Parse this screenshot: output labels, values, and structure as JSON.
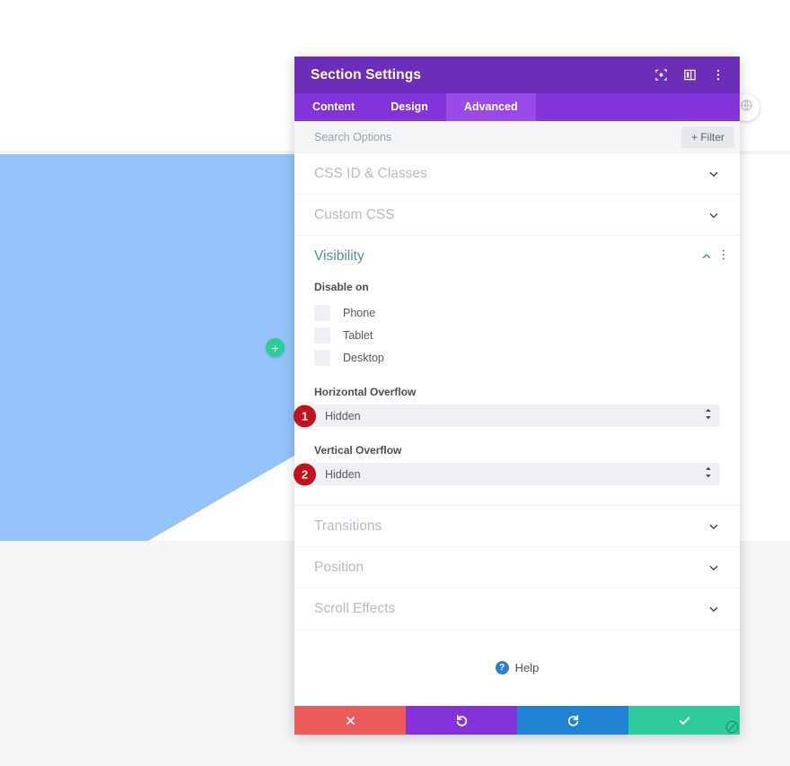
{
  "canvas": {
    "add_section_label": "+",
    "add_section_icon": "plus-icon",
    "round_tool_icon": "globe-settings-icon",
    "section_color": "#94c4fa",
    "add_button_color": "#2ecc9b"
  },
  "modal": {
    "title": "Section Settings",
    "header_icons": [
      {
        "name": "focus-icon",
        "label": ""
      },
      {
        "name": "layout-columns-icon",
        "label": ""
      },
      {
        "name": "kebab-menu-icon",
        "label": ""
      }
    ],
    "tabs": [
      {
        "label": "Content",
        "active": false
      },
      {
        "label": "Design",
        "active": false
      },
      {
        "label": "Advanced",
        "active": true
      }
    ],
    "search": {
      "placeholder": "Search Options",
      "value": ""
    },
    "filter_label": "+ Filter",
    "accordions_top": [
      {
        "label": "CSS ID & Classes",
        "state": "collapsed"
      },
      {
        "label": "Custom CSS",
        "state": "collapsed"
      }
    ],
    "visibility": {
      "title": "Visibility",
      "state": "expanded",
      "disable_on_label": "Disable on",
      "checkboxes": [
        {
          "label": "Phone",
          "checked": false
        },
        {
          "label": "Tablet",
          "checked": false
        },
        {
          "label": "Desktop",
          "checked": false
        }
      ],
      "horizontal_overflow": {
        "label": "Horizontal Overflow",
        "value": "Hidden",
        "step": "1"
      },
      "vertical_overflow": {
        "label": "Vertical Overflow",
        "value": "Hidden",
        "step": "2"
      }
    },
    "accordions_bottom": [
      {
        "label": "Transitions",
        "state": "collapsed"
      },
      {
        "label": "Position",
        "state": "collapsed"
      },
      {
        "label": "Scroll Effects",
        "state": "collapsed"
      }
    ],
    "help": {
      "label": "Help",
      "badge": "?"
    },
    "footer_buttons": [
      {
        "name": "cancel-button",
        "icon": "close-icon",
        "color": "#ec5b5b"
      },
      {
        "name": "undo-button",
        "icon": "undo-icon",
        "color": "#8234d9"
      },
      {
        "name": "redo-button",
        "icon": "redo-icon",
        "color": "#2083d4"
      },
      {
        "name": "save-button",
        "icon": "check-icon",
        "color": "#2ecc9b"
      }
    ],
    "accent_colors": {
      "header_purple": "#6c2eb9",
      "tabs_purple": "#8234d9",
      "tab_active_purple": "#9a4ae8",
      "step_badge_red": "#c1121c",
      "visibility_title": "#5b8a9e"
    }
  }
}
